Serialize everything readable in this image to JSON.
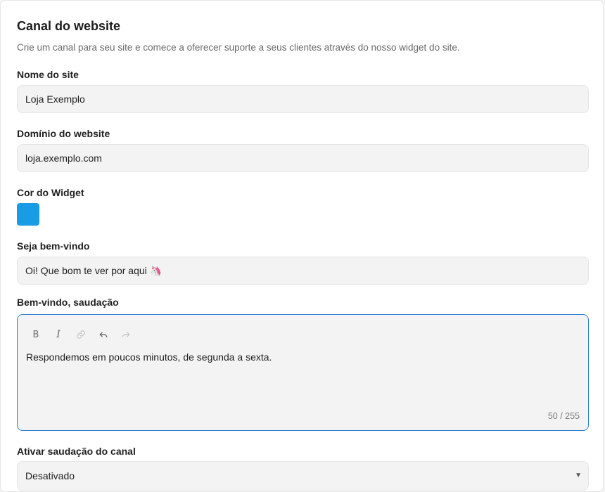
{
  "form": {
    "title": "Canal do website",
    "description": "Crie um canal para seu site e comece a oferecer suporte a seus clientes através do nosso widget do site.",
    "site_name": {
      "label": "Nome do site",
      "value": "Loja Exemplo"
    },
    "domain": {
      "label": "Domínio do website",
      "value": "loja.exemplo.com"
    },
    "widget_color": {
      "label": "Cor do Widget",
      "color": "#1a9be6"
    },
    "welcome_title": {
      "label": "Seja bem-vindo",
      "value": "Oi! Que bom te ver por aqui 🦄"
    },
    "welcome_greeting": {
      "label": "Bem-vindo, saudação",
      "toolbar": {
        "bold": "B",
        "italic": "I",
        "link": "link-icon",
        "undo": "undo-icon",
        "redo": "redo-icon"
      },
      "text": "Respondemos em poucos minutos, de segunda a sexta.",
      "counter": "50 / 255"
    },
    "channel_greeting": {
      "label": "Ativar saudação do canal",
      "value": "Desativado"
    }
  }
}
